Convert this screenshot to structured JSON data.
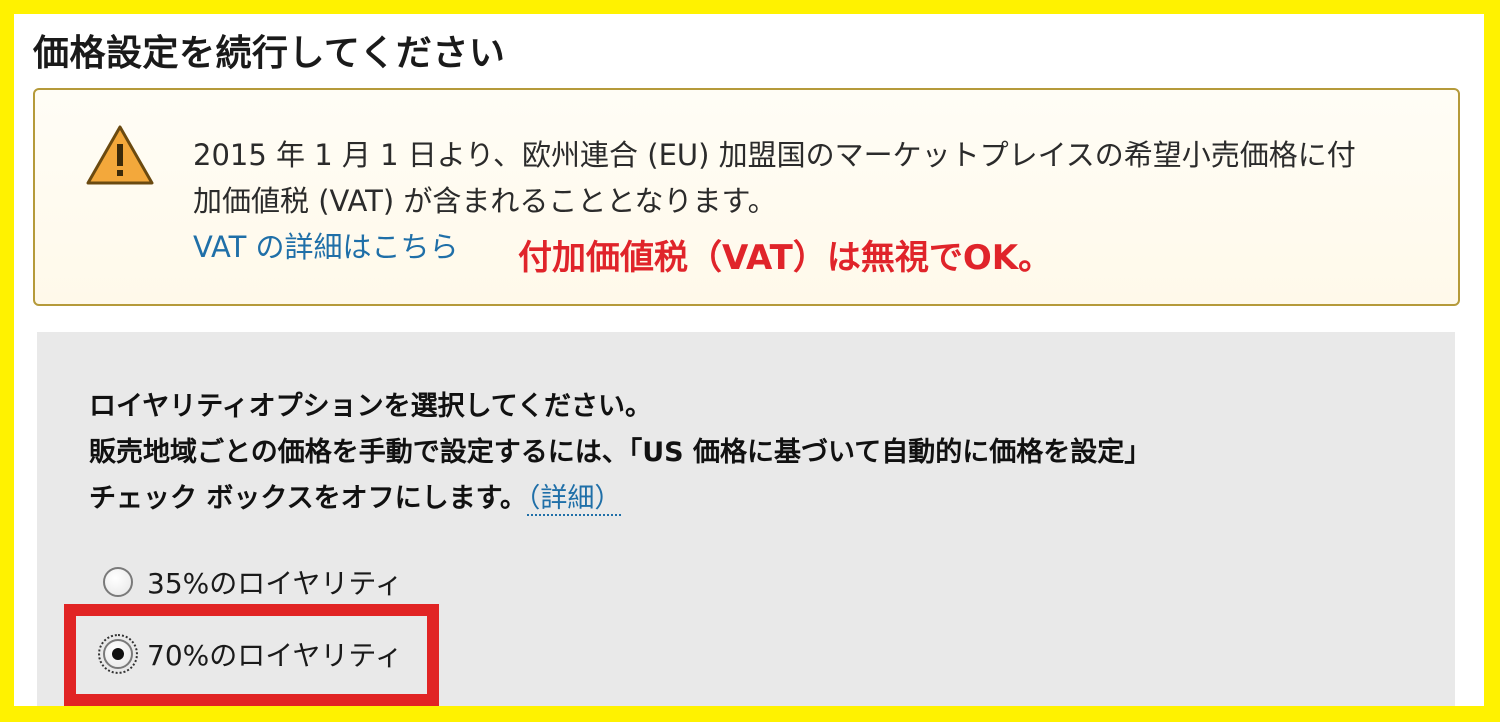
{
  "page": {
    "title": "価格設定を続行してください"
  },
  "alert": {
    "icon": "warning-triangle-icon",
    "lines": [
      "2015 年 1 月 1 日より、欧州連合 (EU) 加盟国のマーケットプレイスの希望小売価格に付",
      "加価値税 (VAT) が含まれることとなります。"
    ],
    "link_label": "VAT の詳細はこちら",
    "annotation": "付加価値税（VAT）は無視でOK。"
  },
  "royalty": {
    "instruction_lines": [
      "ロイヤリティオプションを選択してください。",
      "販売地域ごとの価格を手動で設定するには、「US 価格に基づいて自動的に価格を設定」",
      "チェック ボックスをオフにします。"
    ],
    "details_link": "（詳細）",
    "options": [
      {
        "label": "35%のロイヤリティ",
        "selected": false
      },
      {
        "label": "70%のロイヤリティ",
        "selected": true
      }
    ]
  },
  "colors": {
    "frame": "#fff200",
    "highlight": "#e12424",
    "link": "#1f6fa8",
    "annotation": "#e0242a",
    "panel": "#e9e9e9"
  }
}
